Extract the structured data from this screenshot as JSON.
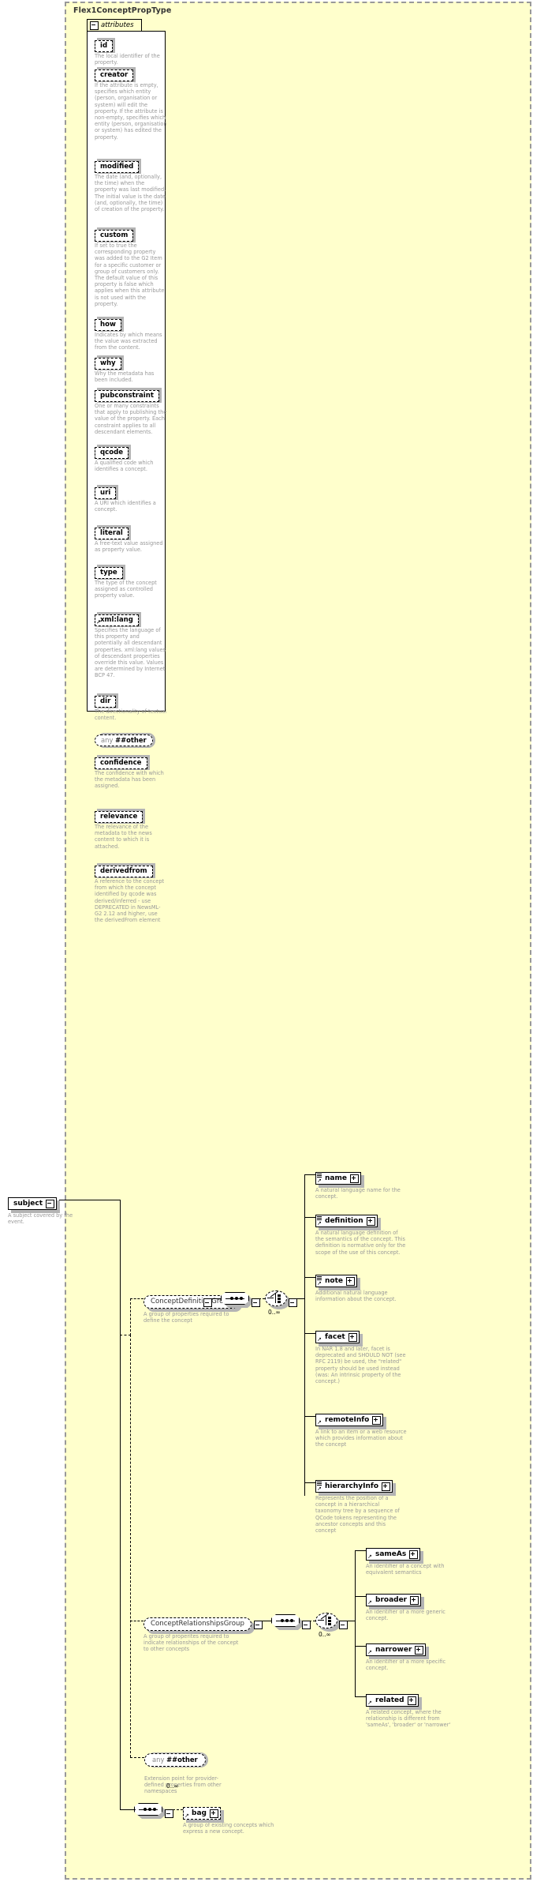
{
  "diagram": {
    "type": "xsd-schema-diagram",
    "complex_type": "Flex1ConceptPropType",
    "attributes_label": "attributes",
    "background_color": "#ffffcc",
    "desc_color": "#999999"
  },
  "attributes": [
    {
      "name": "id",
      "desc": "The local identifier of the property."
    },
    {
      "name": "creator",
      "desc": "If the attribute is empty, specifies which entity (person, organisation or system) will edit the property. If the attribute is non-empty, specifies which entity (person, organisation or system) has edited the property."
    },
    {
      "name": "modified",
      "desc": "The date (and, optionally, the time) when the property was last modified. The initial value is the date (and, optionally, the time) of creation of the property."
    },
    {
      "name": "custom",
      "desc": "If set to true the corresponding property was added to the G2 Item for a specific customer or group of customers only. The default value of this property is false which applies when this attribute is not used with the property."
    },
    {
      "name": "how",
      "desc": "Indicates by which means the value was extracted from the content."
    },
    {
      "name": "why",
      "desc": "Why the metadata has been included."
    },
    {
      "name": "pubconstraint",
      "desc": "One or many constraints that apply to publishing the value of the property. Each constraint applies to all descendant elements."
    },
    {
      "name": "qcode",
      "desc": "A qualified code which identifies a concept."
    },
    {
      "name": "uri",
      "desc": "A URI which identifies a concept."
    },
    {
      "name": "literal",
      "desc": "A free-text value assigned as property value."
    },
    {
      "name": "type",
      "desc": "The type of the concept assigned as controlled property value."
    },
    {
      "name": "xml:lang",
      "desc": "Specifies the language of this property and potentially all descendant properties. xml:lang values of descendant properties override this value. Values are determined by Internet BCP 47."
    },
    {
      "name": "dir",
      "desc": "The directionality of textual content."
    },
    {
      "name": "any ##other",
      "kind": "any",
      "any_prefix": "any",
      "any_ns": "##other",
      "desc": ""
    },
    {
      "name": "confidence",
      "desc": "The confidence with which the metadata has been assigned."
    },
    {
      "name": "relevance",
      "desc": "The relevance of the metadata to the news content to which it is attached."
    },
    {
      "name": "derivedfrom",
      "desc": "A reference to the concept from which the concept identified by qcode was derived/inferred - use DEPRECATED in NewsML-G2 2.12 and higher, use the derivedFrom element"
    }
  ],
  "root_element": {
    "name": "subject",
    "desc": "A subject covered by the event."
  },
  "groups": {
    "concept_definition": {
      "name": "ConceptDefinitionGroup",
      "desc": "A group of properties required to define the concept",
      "occurs": "0..∞",
      "children": [
        {
          "name": "name",
          "desc": "A natural language name for the concept."
        },
        {
          "name": "definition",
          "desc": "A natural language definition of the semantics of the concept. This definition is normative only for the scope of the use of this concept."
        },
        {
          "name": "note",
          "desc": "Additional natural language information about the concept."
        },
        {
          "name": "facet",
          "desc": "In NAR 1.8 and later, facet is deprecated and SHOULD NOT (see RFC 2119) be used, the \"related\" property should be used instead (was: An intrinsic property of the concept.)"
        },
        {
          "name": "remoteInfo",
          "desc": "A link to an item or a web resource which provides information about the concept"
        },
        {
          "name": "hierarchyInfo",
          "desc": "Represents the position of a concept in a hierarchical taxonomy tree by a sequence of QCode tokens representing the ancestor concepts and this concept"
        }
      ]
    },
    "concept_relationships": {
      "name": "ConceptRelationshipsGroup",
      "desc": "A group of properites required to indicate relationships of the concept to other concepts",
      "occurs": "0..∞",
      "children": [
        {
          "name": "sameAs",
          "desc": "An identifier of a concept with equivalent semantics"
        },
        {
          "name": "broader",
          "desc": "An identifier of a more generic concept."
        },
        {
          "name": "narrower",
          "desc": "An identifier of a more specific concept."
        },
        {
          "name": "related",
          "desc": "A related concept, where the relationship is different from 'sameAs', 'broader' or 'narrower'"
        }
      ]
    }
  },
  "extension": {
    "prefix": "any",
    "ns": "##other",
    "occurs": "0..∞",
    "desc": "Extension point for provider-defined properties from other namespaces"
  },
  "bag": {
    "name": "bag",
    "desc": "A group of existing concepts which express a new concept."
  }
}
